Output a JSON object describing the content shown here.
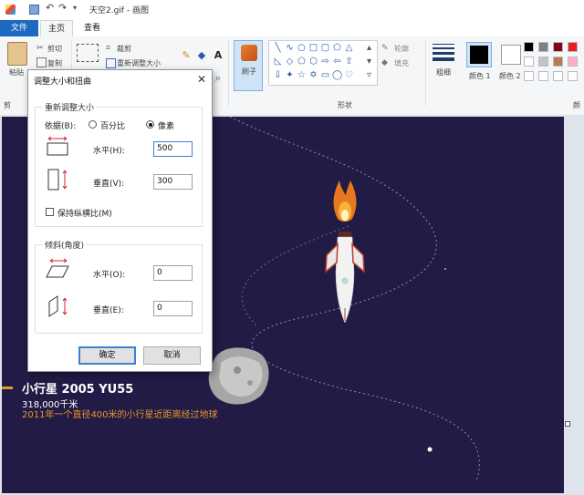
{
  "window": {
    "title": "天空2.gif - 画图"
  },
  "tabs": [
    {
      "label": "文件"
    },
    {
      "label": "主页"
    },
    {
      "label": "查看"
    }
  ],
  "ribbon": {
    "paste": "粘贴",
    "cut": "剪切",
    "copy": "复制",
    "crop": "裁剪",
    "resize": "重新调整大小",
    "brush": "刷子",
    "outline": "轮廓",
    "fill": "填充",
    "shapes_group": "形状",
    "size": "粗细",
    "color1": "颜色 1",
    "color2": "颜色 2",
    "colors_group": "颜",
    "clipboard_group": "剪"
  },
  "palette": [
    "#000000",
    "#7f7f7f",
    "#880015",
    "#ed1c24",
    "#ffffff",
    "#c3c3c3",
    "#b97a57",
    "#ffaec9",
    "#ffffff",
    "#ffffff",
    "#ffffff",
    "#ffffff"
  ],
  "dialog": {
    "title": "调整大小和扭曲",
    "resize_group": "重新调整大小",
    "by_label": "依据(B):",
    "percent_label": "百分比",
    "pixels_label": "像素",
    "horizontal_label": "水平(H):",
    "horizontal_value": "500",
    "vertical_label": "垂直(V):",
    "vertical_value": "300",
    "keep_ratio_label": "保持纵横比(M)",
    "skew_group": "倾斜(角度)",
    "skew_h_label": "水平(O):",
    "skew_h_value": "0",
    "skew_v_label": "垂直(E):",
    "skew_v_value": "0",
    "ok": "确定",
    "cancel": "取消"
  },
  "canvas": {
    "asteroid_name": "小行星 2005 YU55",
    "asteroid_distance": "318,000千米",
    "asteroid_desc": "2011年一个直径400米的小行星近距离经过地球"
  }
}
